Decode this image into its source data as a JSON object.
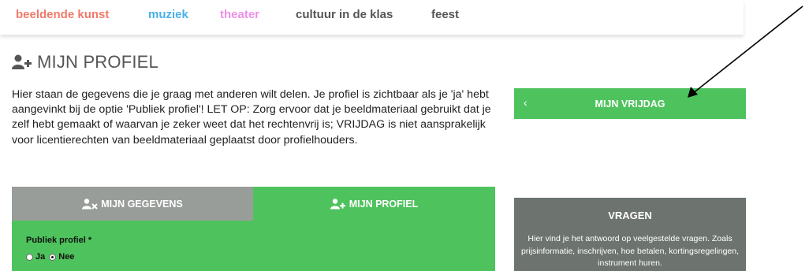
{
  "nav": {
    "items": [
      {
        "label": "beeldende kunst",
        "color": "#f07a6a"
      },
      {
        "label": "muziek",
        "color": "#4ab0e6"
      },
      {
        "label": "theater",
        "color": "#ee8fe8"
      },
      {
        "label": "cultuur in de klas",
        "color": "#555555"
      },
      {
        "label": "feest",
        "color": "#555555"
      }
    ]
  },
  "page": {
    "title": "MIJN PROFIEL",
    "title_icon": "user-plus-icon",
    "intro": "Hier staan de gegevens die je graag met anderen wilt delen. Je profiel is zichtbaar als je 'ja' hebt aangevinkt bij de optie 'Publiek profiel'! LET OP: Zorg ervoor dat je beeldmateriaal gebruikt dat je zelf hebt gemaakt of waarvan je zeker weet dat het rechtenvrij is; VRIJDAG is niet aansprakelijk voor licentierechten van beeldmateriaal geplaatst door profielhouders."
  },
  "sidebar": {
    "back_chevron": "‹",
    "back_button": "MIJN VRIJDAG",
    "vragen": {
      "title": "VRAGEN",
      "text": "Hier vind je het antwoord op veelgestelde vragen. Zoals prijsinformatie, inschrijven, hoe betalen, kortingsregelingen, instrument huren."
    }
  },
  "tabs": [
    {
      "label": "MIJN GEGEVENS",
      "icon": "user-remove-icon",
      "active": false
    },
    {
      "label": "MIJN PROFIEL",
      "icon": "user-plus-icon",
      "active": true
    }
  ],
  "form": {
    "public_profile_label": "Publiek profiel *",
    "options": [
      {
        "label": "Ja",
        "checked": false
      },
      {
        "label": "Nee",
        "checked": true
      }
    ]
  },
  "colors": {
    "green": "#4ec35d",
    "gray_tab": "#999d9a",
    "vragen_bg": "#6d746f"
  }
}
